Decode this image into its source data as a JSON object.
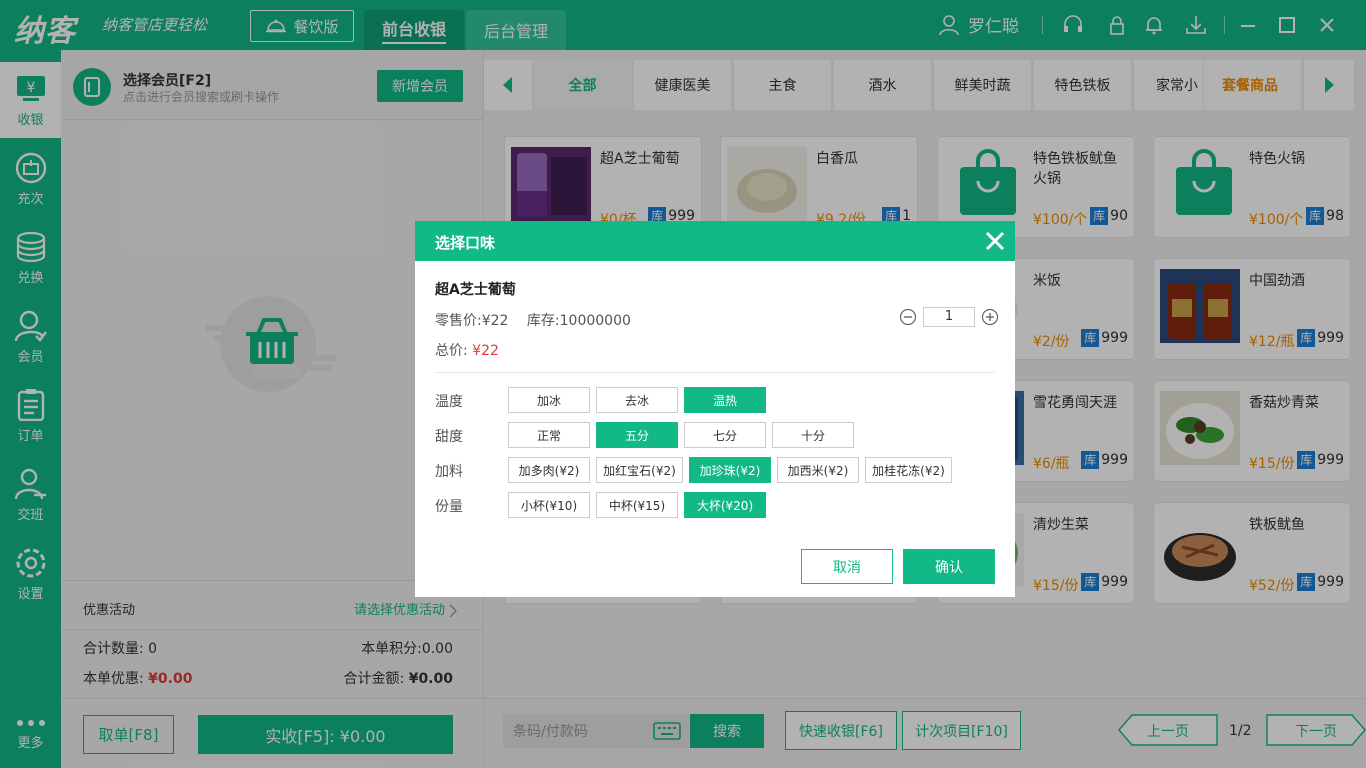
{
  "app": {
    "logo": "纳客",
    "slogan": "纳客管店更轻松",
    "edition": "餐饮版",
    "tabs": [
      "前台收银",
      "后台管理"
    ],
    "user": "罗仁聪"
  },
  "sidebar": {
    "items": [
      "收银",
      "充次",
      "兑换",
      "会员",
      "订单",
      "交班",
      "设置",
      "更多"
    ]
  },
  "member": {
    "title": "选择会员[F2]",
    "hint": "点击进行会员搜索或刷卡操作",
    "new_button": "新增会员"
  },
  "promo": {
    "label": "优惠活动",
    "select": "请选择优惠活动"
  },
  "summary": {
    "qty_label": "合计数量:",
    "qty": "0",
    "points_label": "本单积分:",
    "points": "0.00",
    "discount_label": "本单优惠:",
    "discount": "¥0.00",
    "total_label": "合计金额:",
    "total": "¥0.00"
  },
  "actions": {
    "cancel": "取单[F8]",
    "pay": "实收[F5]: ¥0.00"
  },
  "categories": [
    "全部",
    "健康医美",
    "主食",
    "酒水",
    "鲜美时蔬",
    "特色铁板",
    "家常小",
    "套餐商品"
  ],
  "products": [
    {
      "name": "超A芝士葡萄",
      "price": "¥0/杯",
      "stock": "999"
    },
    {
      "name": "白香瓜",
      "price": "¥9.2/份",
      "stock": "1"
    },
    {
      "name": "特色铁板鱿鱼火锅",
      "price": "¥100/个",
      "stock": "90"
    },
    {
      "name": "特色火锅",
      "price": "¥100/个",
      "stock": "98"
    },
    {
      "name": "米饭",
      "price": "¥2/份",
      "stock": "999"
    },
    {
      "name": "中国劲酒",
      "price": "¥12/瓶",
      "stock": "999"
    },
    {
      "name": "雪花勇闯天涯",
      "price": "¥6/瓶",
      "stock": "999"
    },
    {
      "name": "香菇炒青菜",
      "price": "¥15/份",
      "stock": "999"
    },
    {
      "name": "清炒生菜",
      "price": "¥15/份",
      "stock": "999"
    },
    {
      "name": "铁板鱿鱼",
      "price": "¥52/份",
      "stock": "999"
    }
  ],
  "stock_badge": "库",
  "bottom": {
    "barcode_placeholder": "条码/付款码",
    "search": "搜索",
    "quick_pay": "快速收银[F6]",
    "count_items": "计次项目[F10]",
    "prev": "上一页",
    "page": "1/2",
    "next": "下一页"
  },
  "modal": {
    "title": "选择口味",
    "product": "超A芝士葡萄",
    "retail_label": "零售价:",
    "retail_price": "¥22",
    "stock_label": "库存:",
    "stock": "10000000",
    "total_label": "总价:",
    "total_price": "¥22",
    "qty": "1",
    "groups": [
      {
        "label": "温度",
        "options": [
          "加冰",
          "去冰",
          "温热"
        ],
        "selected": "温热"
      },
      {
        "label": "甜度",
        "options": [
          "正常",
          "五分",
          "七分",
          "十分"
        ],
        "selected": "五分"
      },
      {
        "label": "加料",
        "options": [
          "加多肉(¥2)",
          "加红宝石(¥2)",
          "加珍珠(¥2)",
          "加西米(¥2)",
          "加桂花冻(¥2)"
        ],
        "selected": "加珍珠(¥2)"
      },
      {
        "label": "份量",
        "options": [
          "小杯(¥10)",
          "中杯(¥15)",
          "大杯(¥20)"
        ],
        "selected": "大杯(¥20)"
      }
    ],
    "cancel": "取消",
    "confirm": "确认"
  },
  "colors": {
    "brand": "#12b886",
    "price": "#f08c00",
    "red": "#e03a3a",
    "stock_badge": "#1c7ed6"
  }
}
